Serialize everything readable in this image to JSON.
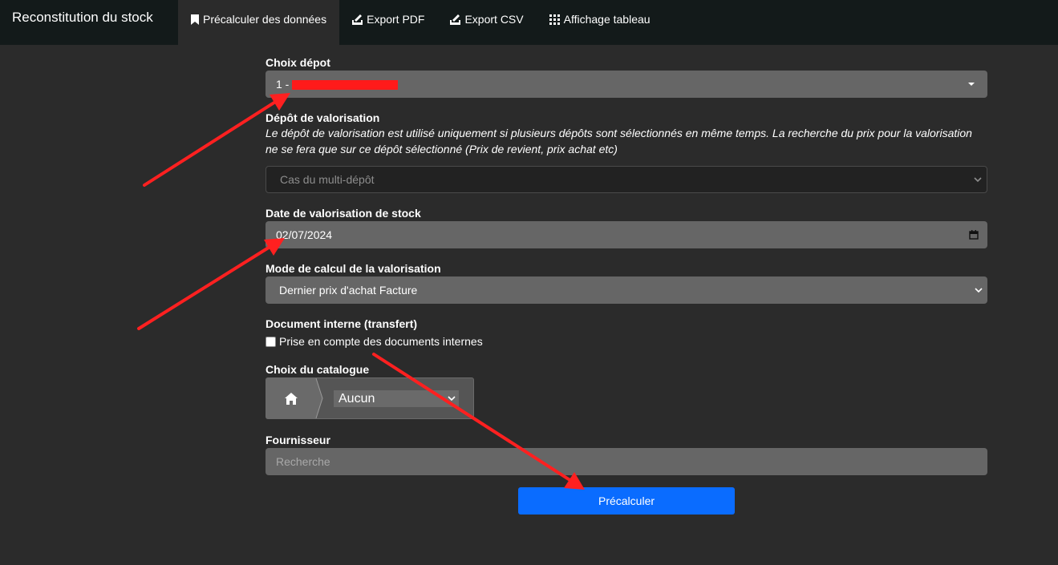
{
  "app_title": "Reconstitution du stock",
  "nav": {
    "precalc": "Précalculer des données",
    "export_pdf": "Export PDF",
    "export_csv": "Export CSV",
    "table_view": "Affichage tableau"
  },
  "form": {
    "depot_label": "Choix dépot",
    "depot_value": "1 -",
    "valorisation_depot_label": "Dépôt de valorisation",
    "valorisation_help": "Le dépôt de valorisation est utilisé uniquement si plusieurs dépôts sont sélectionnés en même temps. La recherche du prix pour la valorisation ne se fera que sur ce dépôt sélectionné (Prix de revient, prix achat etc)",
    "valorisation_depot_value": "Cas du multi-dépôt",
    "date_label": "Date de valorisation de stock",
    "date_value": "02/07/2024",
    "mode_label": "Mode de calcul de la valorisation",
    "mode_value": "Dernier prix d'achat Facture",
    "internal_doc_label": "Document interne (transfert)",
    "internal_doc_checkbox": "Prise en compte des documents internes",
    "catalogue_label": "Choix du catalogue",
    "catalogue_value": "Aucun",
    "supplier_label": "Fournisseur",
    "supplier_placeholder": "Recherche",
    "submit_label": "Précalculer"
  },
  "colors": {
    "primary": "#0a6cff",
    "annotation": "#ff2020",
    "topbar": "#131a1a",
    "background": "#2b2b2b"
  }
}
